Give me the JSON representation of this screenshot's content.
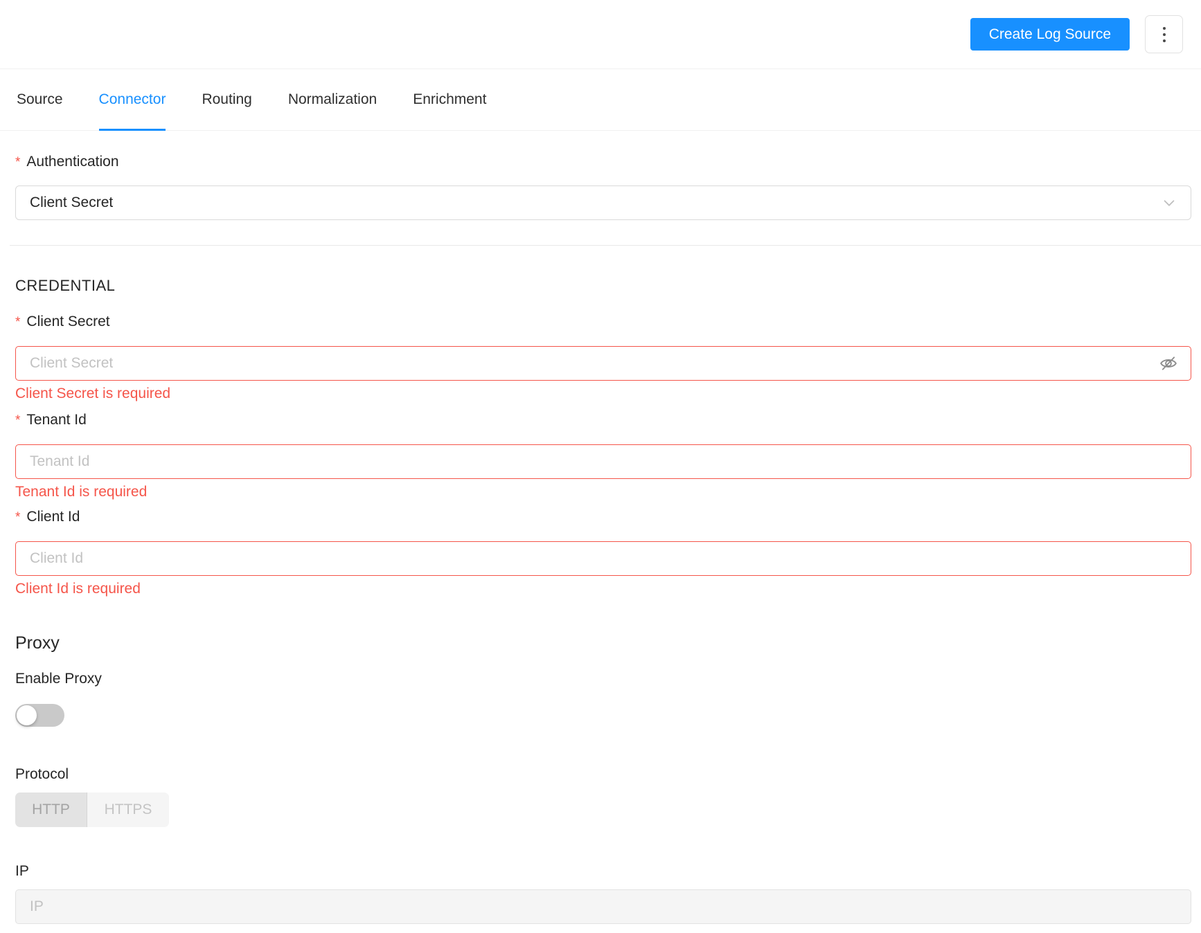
{
  "required_marker": "*",
  "header": {
    "create_button_label": "Create Log Source",
    "more_button_icon": "vertical-ellipsis"
  },
  "tabs": [
    {
      "label": "Source",
      "active": false
    },
    {
      "label": "Connector",
      "active": true
    },
    {
      "label": "Routing",
      "active": false
    },
    {
      "label": "Normalization",
      "active": false
    },
    {
      "label": "Enrichment",
      "active": false
    }
  ],
  "form": {
    "authentication": {
      "label": "Authentication",
      "required": true,
      "selected_value": "Client Secret",
      "dropdown_icon": "chevron-down"
    },
    "credential_section_title": "CREDENTIAL",
    "fields": [
      {
        "label": "Client Secret",
        "placeholder": "Client Secret",
        "value": "",
        "error": "Client Secret is required",
        "suffix_icon": "eye-invisible",
        "required": true
      },
      {
        "label": "Tenant Id",
        "placeholder": "Tenant Id",
        "value": "",
        "error": "Tenant Id is required",
        "required": true
      },
      {
        "label": "Client Id",
        "placeholder": "Client Id",
        "value": "",
        "error": "Client Id is required",
        "required": true
      }
    ],
    "proxy": {
      "title": "Proxy",
      "enable_label": "Enable Proxy",
      "enabled": false,
      "protocol_label": "Protocol",
      "protocol_options": [
        "HTTP",
        "HTTPS"
      ],
      "protocol_selected": "HTTP",
      "protocol_disabled": true,
      "ip_label": "IP",
      "ip_placeholder": "IP",
      "ip_value": "",
      "ip_disabled": true
    }
  },
  "colors": {
    "accent_blue": "#1890ff",
    "error_red": "#f5554a",
    "border_gray": "#d9d9d9",
    "divider_gray": "#f0f0f0",
    "disabled_bg": "#f5f5f5",
    "text_dark": "#262626",
    "placeholder_gray": "#c2c2c2"
  }
}
